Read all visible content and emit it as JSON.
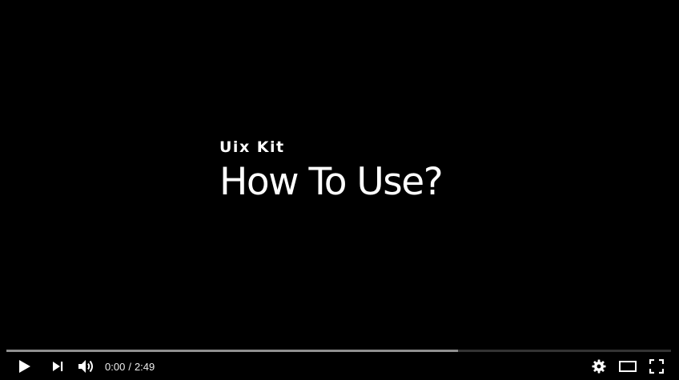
{
  "video": {
    "subtitle": "Uix Kit",
    "title": "How To Use?"
  },
  "player": {
    "current_time": "0:00",
    "separator": "/",
    "duration": "2:49",
    "progress_fraction": 0.0,
    "buffered_fraction": 0.68,
    "colors": {
      "background": "#000000",
      "played": "#f12b24",
      "icons": "#ffffff"
    },
    "icons": {
      "play": "play-icon",
      "next": "next-icon",
      "volume": "volume-icon",
      "settings": "gear-icon",
      "theater": "theater-mode-icon",
      "fullscreen": "fullscreen-icon"
    }
  }
}
